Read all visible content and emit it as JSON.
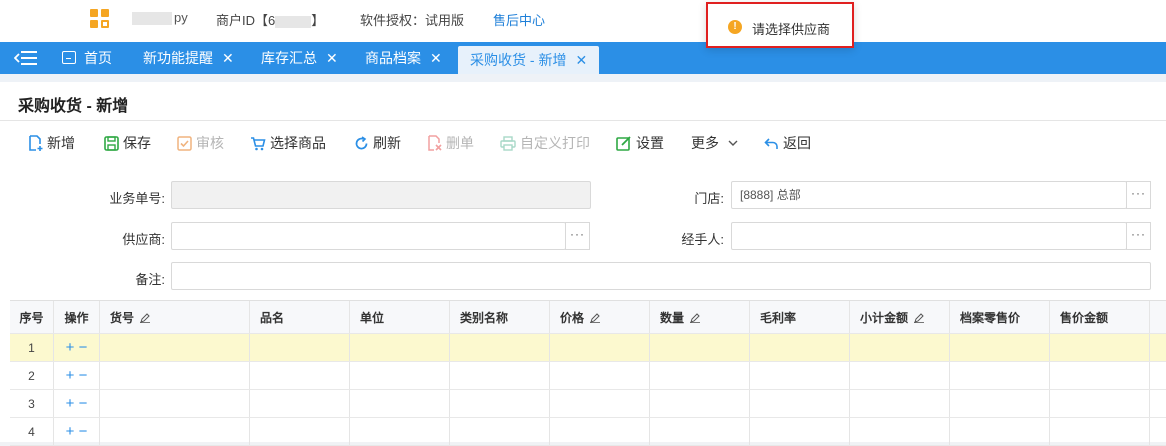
{
  "header": {
    "user_suffix": "py",
    "merchant_label": "商户ID【6",
    "merchant_tail": "】",
    "license": "软件授权：试用版",
    "service": "售后中心"
  },
  "toast": {
    "message": "请选择供应商"
  },
  "tabs": [
    {
      "label": "首页"
    },
    {
      "label": "新功能提醒"
    },
    {
      "label": "库存汇总"
    },
    {
      "label": "商品档案"
    },
    {
      "label": "采购收货 - 新增",
      "active": true
    }
  ],
  "page": {
    "title": "采购收货 - 新增"
  },
  "toolbar": {
    "add": "新增",
    "save": "保存",
    "audit": "审核",
    "select_goods": "选择商品",
    "refresh": "刷新",
    "delete": "删单",
    "custom_print": "自定义打印",
    "settings": "设置",
    "more": "更多",
    "back": "返回"
  },
  "form": {
    "order_no": {
      "label": "业务单号:",
      "value": ""
    },
    "store": {
      "label": "门店:",
      "value": "[8888] 总部"
    },
    "supplier": {
      "label": "供应商:",
      "value": ""
    },
    "handler": {
      "label": "经手人:",
      "value": ""
    },
    "remark": {
      "label": "备注:",
      "value": ""
    },
    "dots": "···"
  },
  "grid": {
    "columns": [
      "序号",
      "操作",
      "货号",
      "品名",
      "单位",
      "类别名称",
      "价格",
      "数量",
      "毛利率",
      "小计金额",
      "档案零售价",
      "售价金额"
    ],
    "rows": [
      {
        "no": "1",
        "ops": "+ −"
      },
      {
        "no": "2",
        "ops": "+ −"
      },
      {
        "no": "3",
        "ops": "+ −"
      },
      {
        "no": "4",
        "ops": "+ −"
      }
    ]
  },
  "colors": {
    "accent": "#2b8fe6",
    "warning": "#f5a623",
    "selected_row": "#fcf9cf"
  }
}
